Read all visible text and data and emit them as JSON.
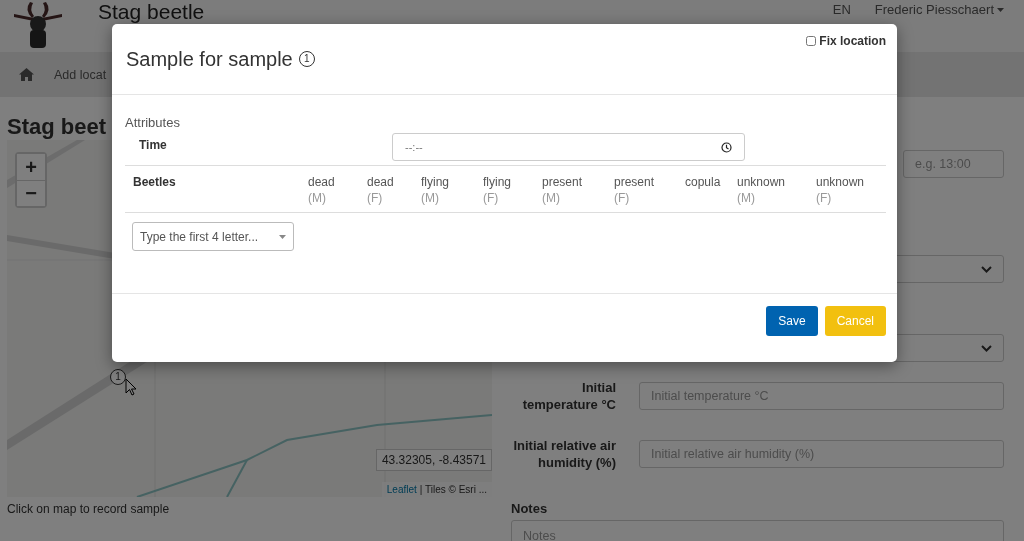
{
  "header": {
    "title": "Stag beetle",
    "language": "EN",
    "user": "Frederic Piesschaert"
  },
  "nav": {
    "items": [
      "Add locat"
    ]
  },
  "page": {
    "heading": "Stag beet"
  },
  "map": {
    "kind": "picture",
    "zoom_in": "+",
    "zoom_out": "−",
    "marker": "1",
    "coordinates": "43.32305, -8.43571",
    "attribution_link": "Leaflet",
    "attribution": "| Tiles © Esri ...",
    "hint": "Click on map to record sample"
  },
  "form": {
    "fields": [
      {
        "kind": "short-input",
        "placeholder": "e.g. 13:00"
      },
      {
        "kind": "select"
      },
      {
        "kind": "select"
      },
      {
        "kind": "input",
        "label": "Initial temperature °C",
        "placeholder": "Initial temperature °C"
      },
      {
        "kind": "input",
        "label": "Initial relative air humidity (%)",
        "placeholder": "Initial relative air humidity (%)"
      },
      {
        "kind": "textarea",
        "label": "Notes",
        "placeholder": "Notes"
      }
    ]
  },
  "modal": {
    "title": "Sample for sample",
    "marker": "1",
    "fix_location": {
      "label": "Fix location",
      "checked": false
    },
    "section": "Attributes",
    "time": {
      "label": "Time",
      "value": "--:--"
    },
    "beetles": {
      "label": "Beetles",
      "columns": [
        {
          "name": "dead",
          "sex": "(M)"
        },
        {
          "name": "dead",
          "sex": "(F)"
        },
        {
          "name": "flying",
          "sex": "(M)"
        },
        {
          "name": "flying",
          "sex": "(F)"
        },
        {
          "name": "present",
          "sex": "(M)"
        },
        {
          "name": "present",
          "sex": "(F)"
        },
        {
          "name": "copula"
        },
        {
          "name": "unknown",
          "sex": "(M)"
        },
        {
          "name": "unknown",
          "sex": "(F)"
        }
      ],
      "select_placeholder": "Type the first 4 letter..."
    },
    "buttons": [
      {
        "kind": "primary",
        "label": "Save"
      },
      {
        "kind": "warning",
        "label": "Cancel"
      }
    ]
  }
}
